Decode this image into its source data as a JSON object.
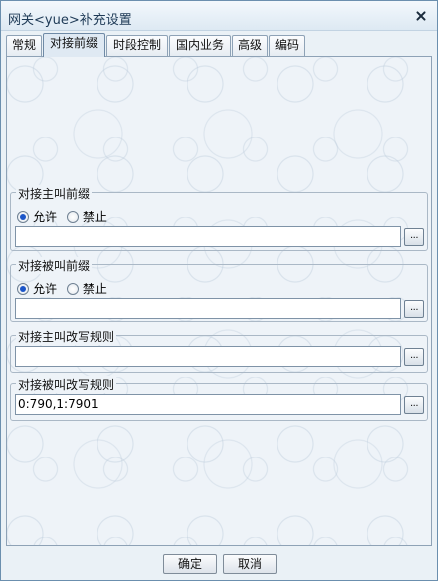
{
  "window": {
    "title": "网关<yue>补充设置",
    "close_icon": "close-icon"
  },
  "tabs": [
    {
      "label": "常规"
    },
    {
      "label": "对接前缀",
      "active": true
    },
    {
      "label": "时段控制"
    },
    {
      "label": "国内业务"
    },
    {
      "label": "高级"
    },
    {
      "label": "编码"
    }
  ],
  "groups": {
    "caller_prefix": {
      "legend": "对接主叫前缀",
      "radio_allow": "允许",
      "radio_deny": "禁止",
      "selected": "允许",
      "value": "",
      "browse_label": "..."
    },
    "callee_prefix": {
      "legend": "对接被叫前缀",
      "radio_allow": "允许",
      "radio_deny": "禁止",
      "selected": "允许",
      "value": "",
      "browse_label": "..."
    },
    "caller_rewrite": {
      "legend": "对接主叫改写规则",
      "value": "",
      "browse_label": "..."
    },
    "callee_rewrite": {
      "legend": "对接被叫改写规则",
      "value": "0:790,1:7901",
      "browse_label": "..."
    }
  },
  "footer": {
    "ok_label": "确定",
    "cancel_label": "取消"
  }
}
